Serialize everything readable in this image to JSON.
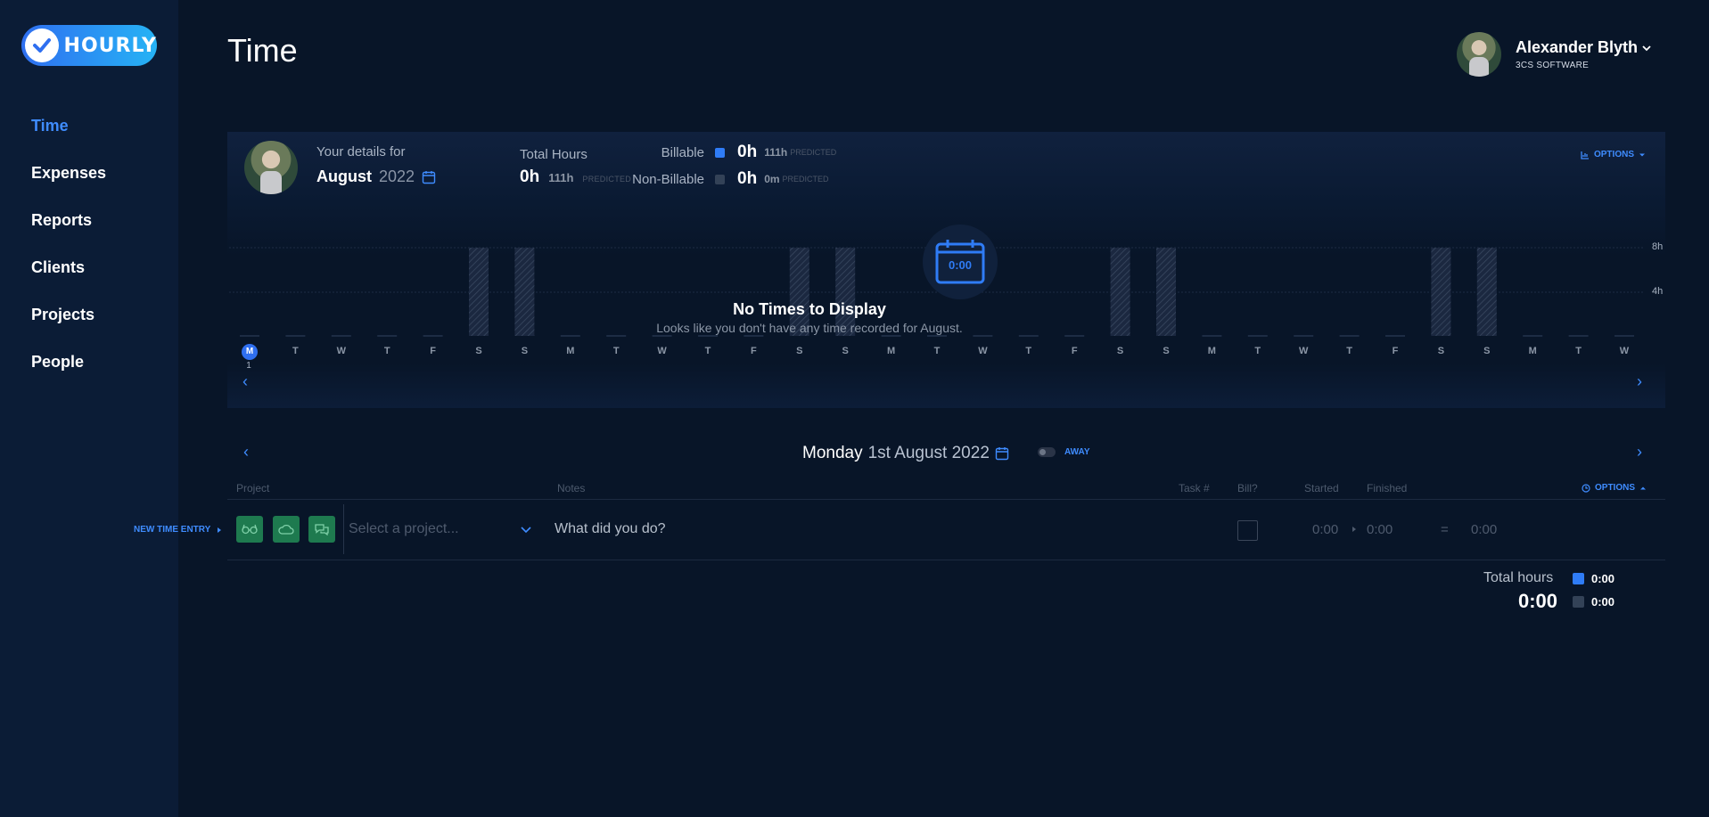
{
  "app": {
    "logo_text": "HOURLY",
    "accent": "#3f8cff"
  },
  "sidebar": {
    "items": [
      {
        "label": "Time",
        "active": true
      },
      {
        "label": "Expenses"
      },
      {
        "label": "Reports"
      },
      {
        "label": "Clients"
      },
      {
        "label": "Projects"
      },
      {
        "label": "People"
      }
    ]
  },
  "header": {
    "title": "Time",
    "user_name": "Alexander Blyth",
    "company": "3CS SOFTWARE"
  },
  "summary": {
    "details_label": "Your details for",
    "month": "August",
    "year": "2022",
    "total_hours_label": "Total Hours",
    "total_hours": "0h",
    "total_predicted": "111h",
    "predicted_tag": "PREDICTED",
    "billable_label": "Billable",
    "billable_value": "0h",
    "billable_predicted": "111h",
    "billable_color": "#2f7cf6",
    "nonbillable_label": "Non-Billable",
    "nonbillable_value": "0h",
    "nonbillable_predicted": "0m",
    "nonbillable_color": "#334257",
    "options_label": "OPTIONS"
  },
  "chart": {
    "grid_labels": [
      "8h",
      "4h"
    ],
    "empty_icon_time": "0:00",
    "empty_title": "No Times to Display",
    "empty_subtitle": "Looks like you don't have any time recorded for August.",
    "days": [
      "M",
      "T",
      "W",
      "T",
      "F",
      "S",
      "S",
      "M",
      "T",
      "W",
      "T",
      "F",
      "S",
      "S",
      "M",
      "T",
      "W",
      "T",
      "F",
      "S",
      "S",
      "M",
      "T",
      "W",
      "T",
      "F",
      "S",
      "S",
      "M",
      "T",
      "W"
    ],
    "today_index": 0,
    "today_num": "1",
    "weekend_indices": [
      5,
      6,
      12,
      13,
      19,
      20,
      26,
      27
    ]
  },
  "day": {
    "weekday": "Monday",
    "date": "1st August 2022",
    "away_label": "AWAY"
  },
  "entry_table": {
    "headers": {
      "project": "Project",
      "notes": "Notes",
      "task": "Task #",
      "bill": "Bill?",
      "started": "Started",
      "finished": "Finished"
    },
    "options_label": "OPTIONS",
    "new_entry_label": "NEW TIME ENTRY",
    "project_placeholder": "Select a project...",
    "notes_placeholder": "What did you do?",
    "started": "0:00",
    "finished": "0:00",
    "equals": "=",
    "duration": "0:00"
  },
  "totals": {
    "label": "Total hours",
    "value": "0:00",
    "billable": "0:00",
    "nonbillable": "0:00"
  }
}
